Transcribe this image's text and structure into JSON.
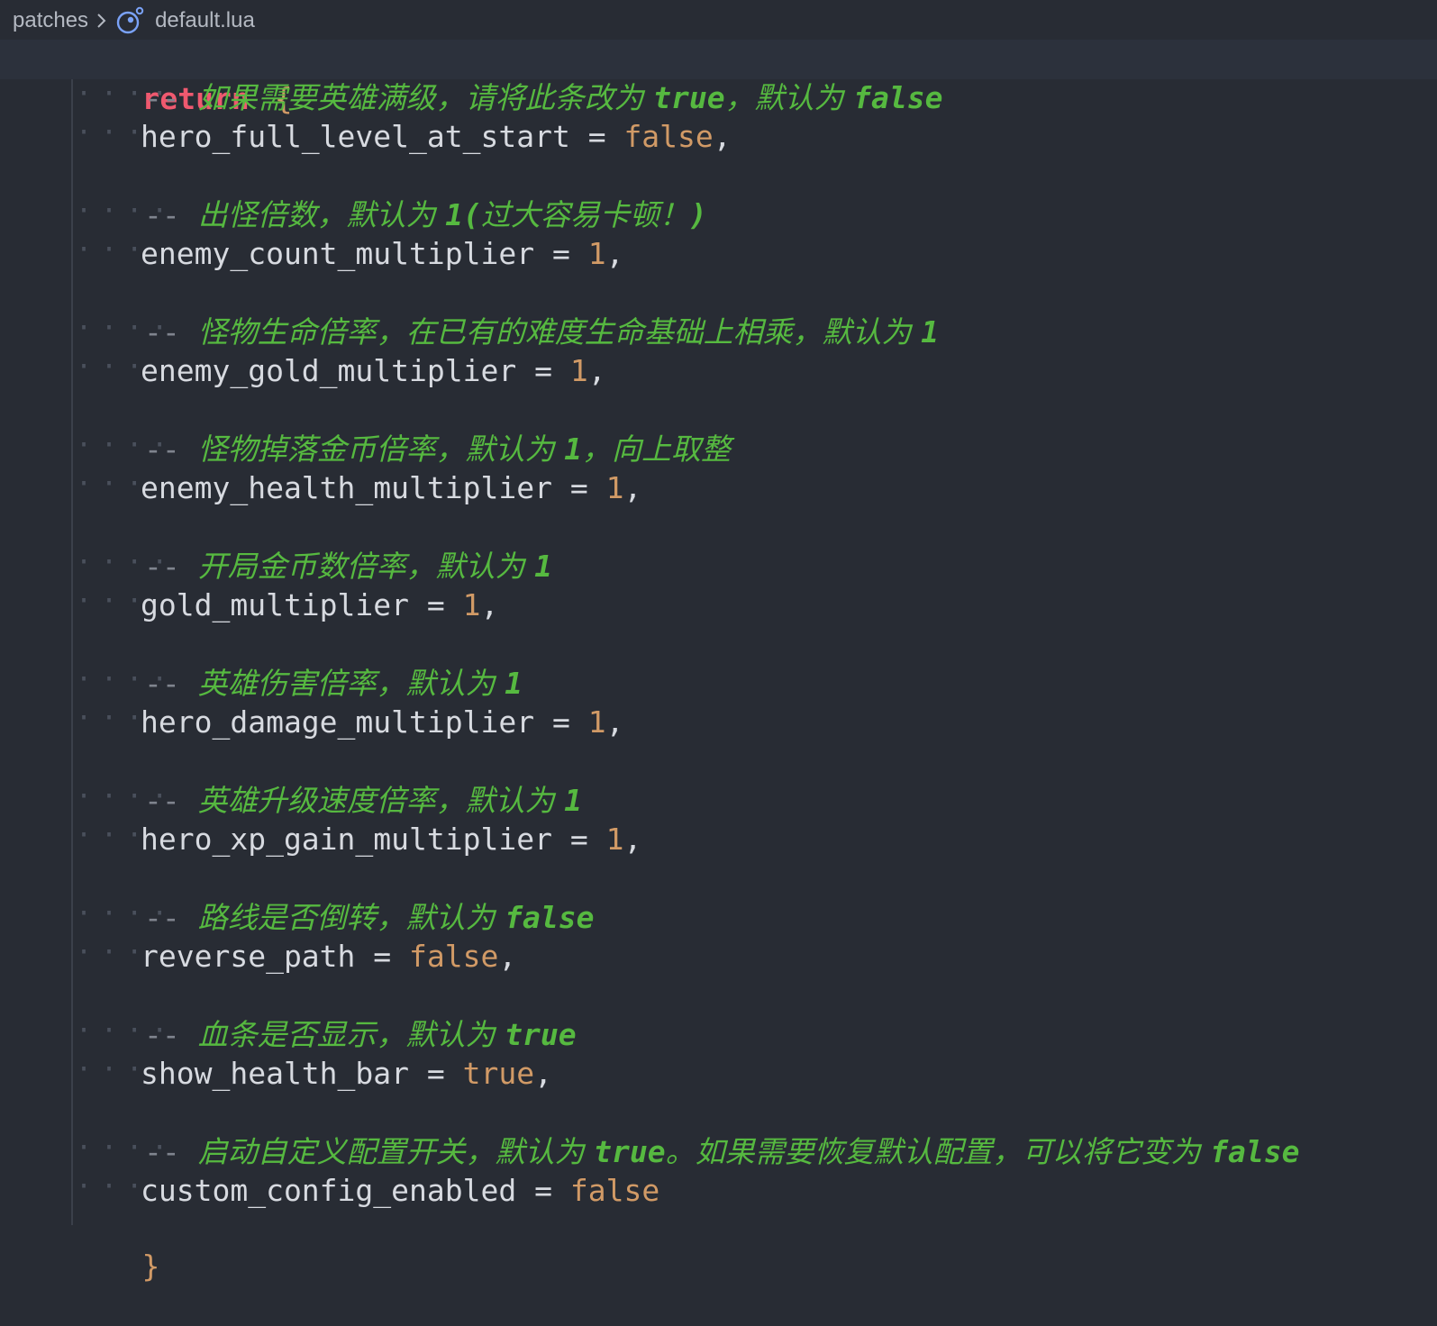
{
  "breadcrumb": {
    "folder": "patches",
    "file": "default.lua"
  },
  "code": {
    "open": {
      "keyword": "return",
      "brace": "{"
    },
    "close": "}",
    "entries": [
      {
        "comment_parts": [
          {
            "t": "如果需要英雄满级，请将此条改为 ",
            "b": false
          },
          {
            "t": "true",
            "b": true
          },
          {
            "t": "，默认为 ",
            "b": false
          },
          {
            "t": "false",
            "b": true
          }
        ],
        "key": "hero_full_level_at_start",
        "value": "false",
        "value_type": "bool",
        "trail": ","
      },
      {
        "comment_parts": [
          {
            "t": "出怪倍数，默认为 ",
            "b": false
          },
          {
            "t": "1(",
            "b": true
          },
          {
            "t": "过大容易卡顿！",
            "b": false
          },
          {
            "t": ")",
            "b": true
          }
        ],
        "key": "enemy_count_multiplier",
        "value": "1",
        "value_type": "num",
        "trail": ","
      },
      {
        "comment_parts": [
          {
            "t": "怪物生命倍率，在已有的难度生命基础上相乘，默认为 ",
            "b": false
          },
          {
            "t": "1",
            "b": true
          }
        ],
        "key": "enemy_gold_multiplier",
        "value": "1",
        "value_type": "num",
        "trail": ","
      },
      {
        "comment_parts": [
          {
            "t": "怪物掉落金币倍率，默认为 ",
            "b": false
          },
          {
            "t": "1",
            "b": true
          },
          {
            "t": "，向上取整",
            "b": false
          }
        ],
        "key": "enemy_health_multiplier",
        "value": "1",
        "value_type": "num",
        "trail": ","
      },
      {
        "comment_parts": [
          {
            "t": "开局金币数倍率，默认为 ",
            "b": false
          },
          {
            "t": "1",
            "b": true
          }
        ],
        "key": "gold_multiplier",
        "value": "1",
        "value_type": "num",
        "trail": ","
      },
      {
        "comment_parts": [
          {
            "t": "英雄伤害倍率，默认为 ",
            "b": false
          },
          {
            "t": "1",
            "b": true
          }
        ],
        "key": "hero_damage_multiplier",
        "value": "1",
        "value_type": "num",
        "trail": ","
      },
      {
        "comment_parts": [
          {
            "t": "英雄升级速度倍率，默认为 ",
            "b": false
          },
          {
            "t": "1",
            "b": true
          }
        ],
        "key": "hero_xp_gain_multiplier",
        "value": "1",
        "value_type": "num",
        "trail": ","
      },
      {
        "comment_parts": [
          {
            "t": "路线是否倒转，默认为 ",
            "b": false
          },
          {
            "t": "false",
            "b": true
          }
        ],
        "key": "reverse_path",
        "value": "false",
        "value_type": "bool",
        "trail": ","
      },
      {
        "comment_parts": [
          {
            "t": "血条是否显示，默认为 ",
            "b": false
          },
          {
            "t": "true",
            "b": true
          }
        ],
        "key": "show_health_bar",
        "value": "true",
        "value_type": "bool",
        "trail": ","
      },
      {
        "comment_parts": [
          {
            "t": "启动自定义配置开关，默认为 ",
            "b": false
          },
          {
            "t": "true",
            "b": true
          },
          {
            "t": "。如果需要恢复默认配置，可以将它变为 ",
            "b": false
          },
          {
            "t": "false",
            "b": true
          }
        ],
        "key": "custom_config_enabled",
        "value": "false",
        "value_type": "bool",
        "trail": ""
      }
    ]
  },
  "colors": {
    "background": "#282c34",
    "keyword": "#ef596f",
    "comment": "#56b940",
    "identifier": "#d7dae0",
    "literal": "#d19a66"
  },
  "icons": {
    "separator": "chevron-right-icon",
    "file": "lua-file-icon"
  }
}
